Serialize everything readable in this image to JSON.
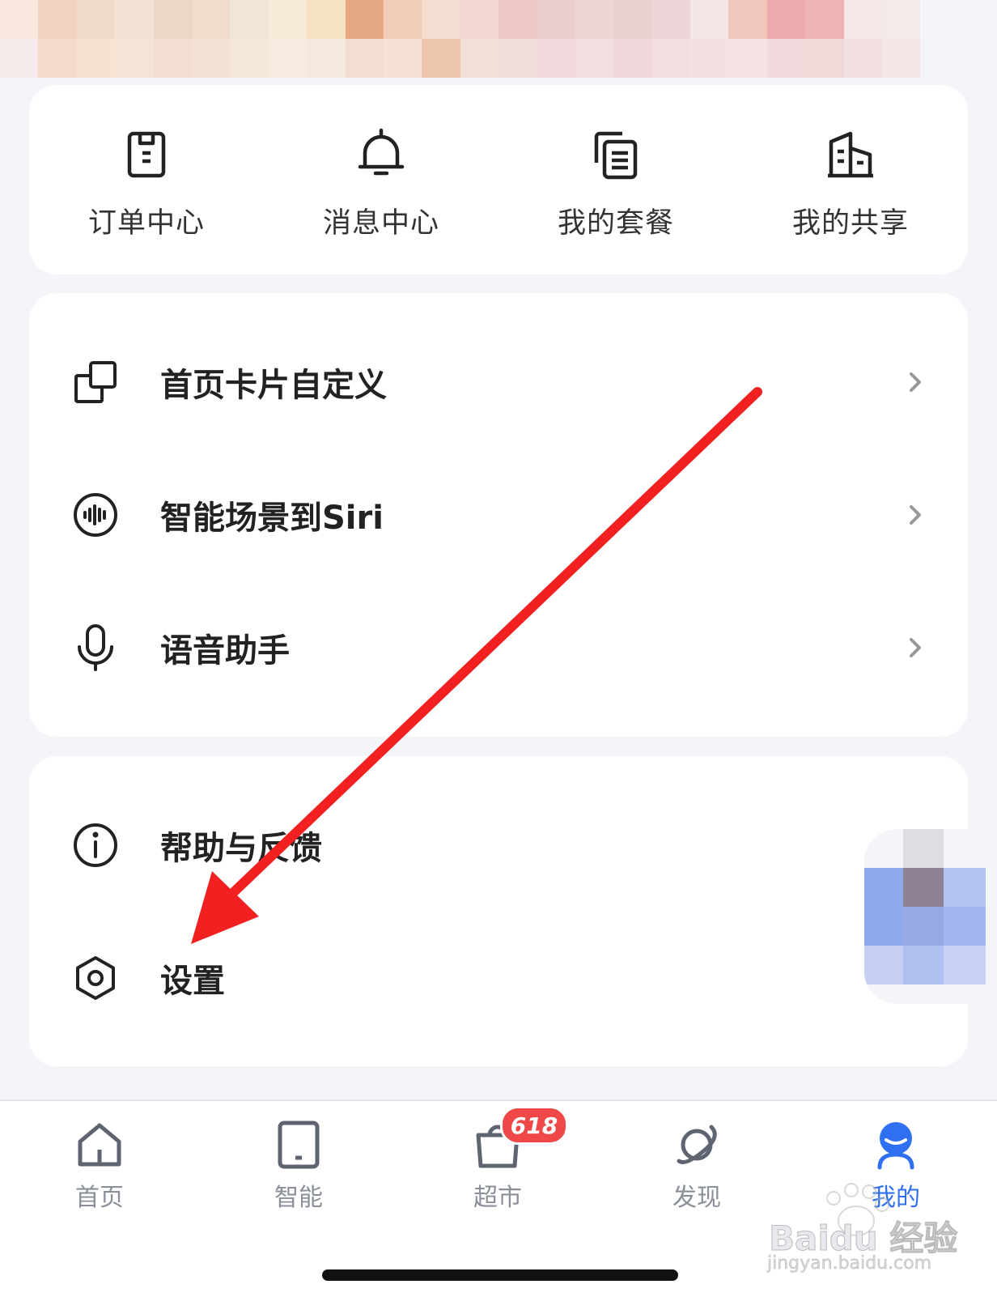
{
  "colors": {
    "accent": "#2f6ff1",
    "badge": "#f04848",
    "arrow": "#f22020"
  },
  "quick_actions": [
    {
      "label": "订单中心",
      "icon": "clipboard-icon"
    },
    {
      "label": "消息中心",
      "icon": "bell-icon"
    },
    {
      "label": "我的套餐",
      "icon": "package-icon"
    },
    {
      "label": "我的共享",
      "icon": "share-building-icon"
    }
  ],
  "menu_group1": [
    {
      "label": "首页卡片自定义",
      "icon": "cards-icon"
    },
    {
      "label": "智能场景到Siri",
      "icon": "siri-wave-icon"
    },
    {
      "label": "语音助手",
      "icon": "microphone-icon"
    }
  ],
  "menu_group2": [
    {
      "label": "帮助与反馈",
      "icon": "info-icon"
    },
    {
      "label": "设置",
      "icon": "hex-gear-icon"
    }
  ],
  "tabbar": {
    "tabs": [
      {
        "label": "首页",
        "icon": "home-icon"
      },
      {
        "label": "智能",
        "icon": "tablet-icon"
      },
      {
        "label": "超市",
        "icon": "shopping-bag-icon"
      },
      {
        "label": "发现",
        "icon": "planet-icon"
      },
      {
        "label": "我的",
        "icon": "user-icon",
        "active": true
      }
    ],
    "badge_text": "618"
  },
  "watermark": {
    "text": "Baidu 经验",
    "url": "jingyan.baidu.com"
  }
}
